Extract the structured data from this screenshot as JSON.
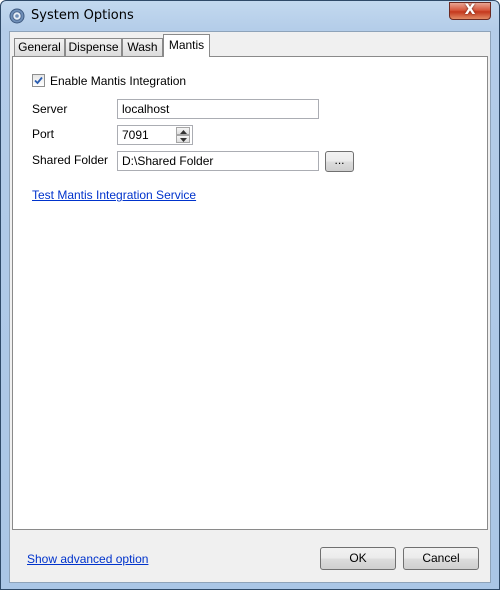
{
  "window": {
    "title": "System Options",
    "close_glyph": "X",
    "icon": "gear-icon"
  },
  "tabs": [
    {
      "label": "General",
      "active": false
    },
    {
      "label": "Dispense",
      "active": false
    },
    {
      "label": "Wash",
      "active": false
    },
    {
      "label": "Mantis",
      "active": true
    }
  ],
  "mantis": {
    "enable_label": "Enable Mantis Integration",
    "enable_checked": true,
    "server_label": "Server",
    "server_value": "localhost",
    "port_label": "Port",
    "port_value": "7091",
    "shared_folder_label": "Shared Folder",
    "shared_folder_value": "D:\\Shared Folder",
    "browse_label": "...",
    "test_link": "Test Mantis Integration Service"
  },
  "footer": {
    "advanced_link": "Show advanced option",
    "ok_label": "OK",
    "cancel_label": "Cancel"
  },
  "colors": {
    "link": "#0033cc",
    "titlebar": "#b4cde9",
    "close_button": "#c4381d"
  }
}
